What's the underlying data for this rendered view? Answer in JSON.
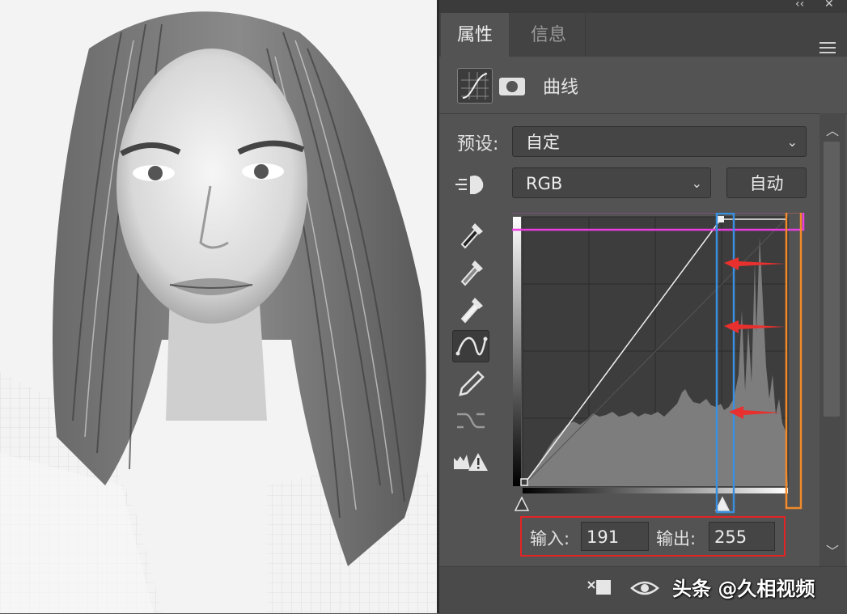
{
  "panel": {
    "tabs": [
      {
        "label": "属性",
        "active": true
      },
      {
        "label": "信息",
        "active": false
      }
    ],
    "adjustment": {
      "title": "曲线",
      "icons": [
        "curves-adjustment-icon",
        "layer-mask-icon"
      ]
    },
    "preset": {
      "label": "预设:",
      "value": "自定"
    },
    "channel": {
      "value": "RGB"
    },
    "auto_label": "自动",
    "input": {
      "label": "输入:",
      "value": "191"
    },
    "output": {
      "label": "输出:",
      "value": "255"
    },
    "tools": [
      "targeted-adjustment-icon",
      "black-eyedropper-icon",
      "gray-eyedropper-icon",
      "white-eyedropper-icon",
      "curve-points-icon",
      "pencil-icon",
      "smooth-icon",
      "clipping-warning-icon"
    ],
    "bottom_icons": [
      "clip-to-layer-icon",
      "visibility-eye-icon"
    ]
  },
  "curve": {
    "points": [
      [
        0,
        0
      ],
      [
        191,
        255
      ],
      [
        255,
        255
      ]
    ],
    "annotation_colors": {
      "pink": "#e83ee0",
      "blue": "#3b8fe0",
      "orange": "#f08a2a",
      "red": "#e32424",
      "arrow": "#e8302e"
    }
  },
  "watermark": "头条 @久相视频"
}
